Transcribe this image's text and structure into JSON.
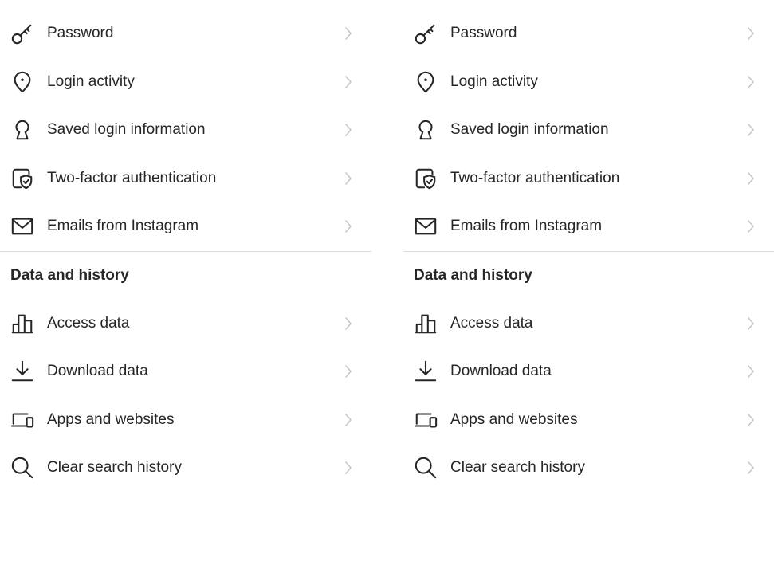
{
  "security": {
    "items": [
      {
        "label": "Password",
        "icon": "key-icon"
      },
      {
        "label": "Login activity",
        "icon": "location-pin-icon"
      },
      {
        "label": "Saved login information",
        "icon": "keyhole-icon"
      },
      {
        "label": "Two-factor authentication",
        "icon": "phone-shield-icon"
      },
      {
        "label": "Emails from Instagram",
        "icon": "envelope-icon"
      }
    ]
  },
  "data_history": {
    "title": "Data and history",
    "items": [
      {
        "label": "Access data",
        "icon": "bar-chart-icon"
      },
      {
        "label": "Download data",
        "icon": "download-icon"
      },
      {
        "label": "Apps and websites",
        "icon": "laptop-phone-icon"
      },
      {
        "label": "Clear search history",
        "icon": "search-icon"
      }
    ]
  },
  "colors": {
    "text": "#262626",
    "chevron": "#c7c7c7",
    "divider": "#dbdbdb",
    "background": "#ffffff"
  }
}
